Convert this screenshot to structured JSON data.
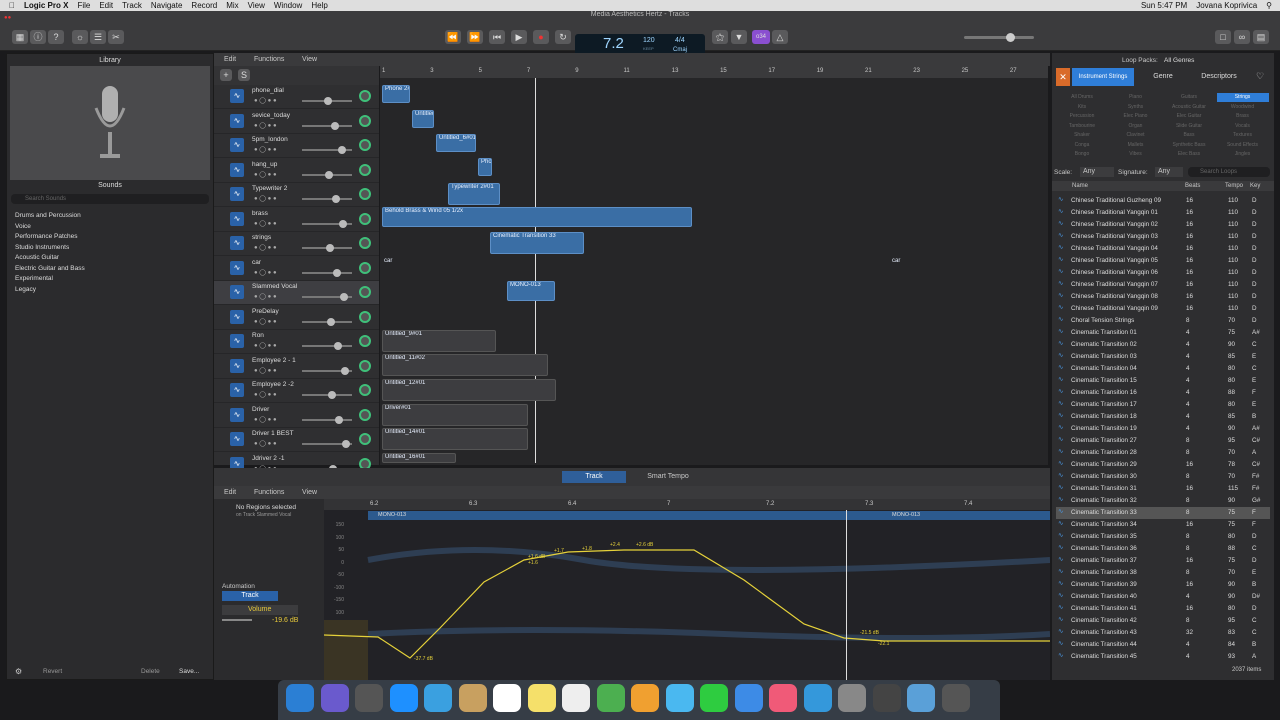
{
  "menubar": {
    "app": "Logic Pro X",
    "items": [
      "File",
      "Edit",
      "Track",
      "Navigate",
      "Record",
      "Mix",
      "View",
      "Window",
      "Help"
    ],
    "clock": "Sun 5:47 PM",
    "user": "Jovana Koprivica"
  },
  "window": {
    "title": "Media Aesthetics Hertz - Tracks"
  },
  "lcd": {
    "position": "7.2",
    "tempo": "120",
    "tempo_label": "KEEP",
    "key": "Cmaj",
    "signature": "4/4",
    "bar_label": "BAR",
    "beat_label": "BEAT",
    "tempo_sub": "TEMPO"
  },
  "toolbar": {
    "tuner_badge": "o34"
  },
  "library": {
    "title": "Library",
    "subtitle": "Sounds",
    "search_placeholder": "Search Sounds",
    "categories": [
      "Drums and Percussion",
      "Voice",
      "Performance Patches",
      "Studio Instruments",
      "Acoustic Guitar",
      "Electric Guitar and Bass",
      "Experimental",
      "Legacy"
    ],
    "revert": "Revert",
    "delete": "Delete",
    "save": "Save..."
  },
  "menus": {
    "edit": "Edit",
    "functions": "Functions",
    "view": "View"
  },
  "ruler": [
    "1",
    "3",
    "5",
    "7",
    "9",
    "11",
    "13",
    "15",
    "17",
    "19",
    "21",
    "23",
    "25",
    "27"
  ],
  "tracks": [
    {
      "name": "phone_dial"
    },
    {
      "name": "sevice_today"
    },
    {
      "name": "5pm_london"
    },
    {
      "name": "hang_up"
    },
    {
      "name": "Typewriter 2"
    },
    {
      "name": "brass"
    },
    {
      "name": "strings"
    },
    {
      "name": "car"
    },
    {
      "name": "Slammed Vocal"
    },
    {
      "name": "PreDelay"
    },
    {
      "name": "Ron"
    },
    {
      "name": "Employee 2 - 1"
    },
    {
      "name": "Employee 2 -2"
    },
    {
      "name": "Driver"
    },
    {
      "name": "Driver 1  BEST"
    },
    {
      "name": "Jdriver 2 -1"
    }
  ],
  "regions": [
    "Phone 2#",
    "Untitled",
    "Untitled_6#01",
    "Pho",
    "Typewriter 2#01",
    "Behold Brass & Wind 05  1/2x",
    "Cinematic Transition 33",
    "car",
    "car",
    "MONO-013",
    "Untitled_9#01",
    "Untitled_11#02",
    "Untitled_12#01",
    "Driver#01",
    "Untitled_14#01",
    "Untitled_16#01"
  ],
  "editor": {
    "tabs": [
      "Track",
      "Smart Tempo"
    ],
    "no_regions": "No Regions selected",
    "on_track": "on Track Slammed Vocal",
    "automation": "Automation",
    "track_btn": "Track",
    "param": "Volume",
    "value": "-19.6 dB",
    "ruler": [
      "6.2",
      "6.3",
      "6.4",
      "7",
      "7.2",
      "7.3",
      "7.4"
    ],
    "region_a": "MONO-013",
    "region_b": "MONO-013",
    "yaxis": [
      "150",
      "100",
      "50",
      "0",
      "-50",
      "-100",
      "-150",
      "100",
      "50",
      "0",
      "-50",
      "-100"
    ],
    "labels": [
      "-37.7 dB",
      "+1.6 dB",
      "+1.7",
      "+1.8",
      "+2.4",
      "+2.6 dB",
      "+1.6",
      "-21.5 dB",
      "-22.1"
    ]
  },
  "loops": {
    "packs_label": "Loop Packs:",
    "packs_value": "All Genres",
    "tabs": [
      "Instrument Strings",
      "Genre",
      "Descriptors"
    ],
    "grid": [
      "All Drums",
      "Piano",
      "Guitars",
      "Strings",
      "Kits",
      "Synths",
      "Acoustic Guitar",
      "Woodwind",
      "Percussion",
      "Elec Piano",
      "Elec Guitar",
      "Brass",
      "Tambourine",
      "Organ",
      "Slide Guitar",
      "Vocals",
      "Shaker",
      "Clavinet",
      "Bass",
      "Textures",
      "Conga",
      "Mallets",
      "Synthetic Bass",
      "Sound Effects",
      "Bongo",
      "Vibes",
      "Elec Bass",
      "Jingles"
    ],
    "scale_label": "Scale:",
    "scale": "Any",
    "sig_label": "Signature:",
    "sig": "Any",
    "search_placeholder": "Search Loops",
    "col_name": "Name",
    "col_beats": "Beats",
    "col_tempo": "Tempo",
    "col_key": "Key",
    "rows": [
      [
        "Chinese Traditional Guzheng 09",
        "16",
        "110",
        "D"
      ],
      [
        "Chinese Traditional Yangqin 01",
        "16",
        "110",
        "D"
      ],
      [
        "Chinese Traditional Yangqin 02",
        "16",
        "110",
        "D"
      ],
      [
        "Chinese Traditional Yangqin 03",
        "16",
        "110",
        "D"
      ],
      [
        "Chinese Traditional Yangqin 04",
        "16",
        "110",
        "D"
      ],
      [
        "Chinese Traditional Yangqin 05",
        "16",
        "110",
        "D"
      ],
      [
        "Chinese Traditional Yangqin 06",
        "16",
        "110",
        "D"
      ],
      [
        "Chinese Traditional Yangqin 07",
        "16",
        "110",
        "D"
      ],
      [
        "Chinese Traditional Yangqin 08",
        "16",
        "110",
        "D"
      ],
      [
        "Chinese Traditional Yangqin 09",
        "16",
        "110",
        "D"
      ],
      [
        "Choral Tension Strings",
        "8",
        "70",
        "D"
      ],
      [
        "Cinematic Transition 01",
        "4",
        "75",
        "A#"
      ],
      [
        "Cinematic Transition 02",
        "4",
        "90",
        "C"
      ],
      [
        "Cinematic Transition 03",
        "4",
        "85",
        "E"
      ],
      [
        "Cinematic Transition 04",
        "4",
        "80",
        "C"
      ],
      [
        "Cinematic Transition 15",
        "4",
        "80",
        "E"
      ],
      [
        "Cinematic Transition 16",
        "4",
        "88",
        "F"
      ],
      [
        "Cinematic Transition 17",
        "4",
        "80",
        "E"
      ],
      [
        "Cinematic Transition 18",
        "4",
        "85",
        "B"
      ],
      [
        "Cinematic Transition 19",
        "4",
        "90",
        "A#"
      ],
      [
        "Cinematic Transition 27",
        "8",
        "95",
        "C#"
      ],
      [
        "Cinematic Transition 28",
        "8",
        "70",
        "A"
      ],
      [
        "Cinematic Transition 29",
        "16",
        "78",
        "C#"
      ],
      [
        "Cinematic Transition 30",
        "8",
        "70",
        "F#"
      ],
      [
        "Cinematic Transition 31",
        "16",
        "115",
        "F#"
      ],
      [
        "Cinematic Transition 32",
        "8",
        "90",
        "G#"
      ],
      [
        "Cinematic Transition 33",
        "8",
        "75",
        "F"
      ],
      [
        "Cinematic Transition 34",
        "16",
        "75",
        "F"
      ],
      [
        "Cinematic Transition 35",
        "8",
        "80",
        "D"
      ],
      [
        "Cinematic Transition 36",
        "8",
        "88",
        "C"
      ],
      [
        "Cinematic Transition 37",
        "16",
        "75",
        "D"
      ],
      [
        "Cinematic Transition 38",
        "8",
        "70",
        "E"
      ],
      [
        "Cinematic Transition 39",
        "16",
        "90",
        "B"
      ],
      [
        "Cinematic Transition 40",
        "4",
        "90",
        "D#"
      ],
      [
        "Cinematic Transition 41",
        "16",
        "80",
        "D"
      ],
      [
        "Cinematic Transition 42",
        "8",
        "95",
        "C"
      ],
      [
        "Cinematic Transition 43",
        "32",
        "83",
        "C"
      ],
      [
        "Cinematic Transition 44",
        "4",
        "84",
        "B"
      ],
      [
        "Cinematic Transition 45",
        "4",
        "93",
        "A"
      ]
    ],
    "count": "2037 items"
  },
  "colors": {
    "region_blue": "#3a6ea5",
    "automation": "#e6d23a",
    "accent": "#2f7ed8"
  }
}
